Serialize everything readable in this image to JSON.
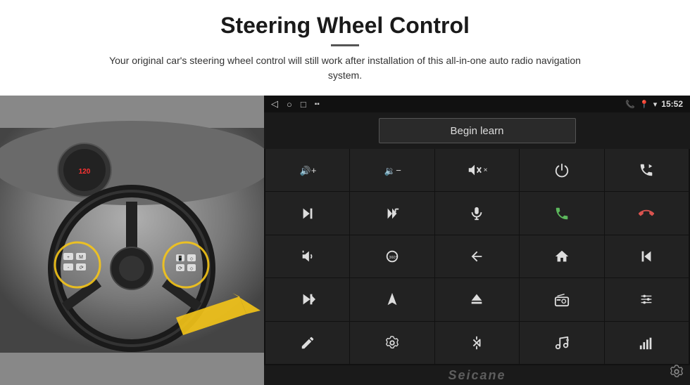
{
  "header": {
    "title": "Steering Wheel Control",
    "subtitle": "Your original car's steering wheel control will still work after installation of this all-in-one auto radio navigation system."
  },
  "screen": {
    "status_bar": {
      "time": "15:52",
      "icons_left": [
        "back-arrow",
        "home-circle",
        "square"
      ],
      "icons_right": [
        "phone-icon",
        "location-icon",
        "wifi-icon",
        "battery-icon"
      ]
    },
    "begin_learn_label": "Begin learn",
    "watermark": "Seicane",
    "icons": [
      {
        "id": "vol-up",
        "symbol": "🔊+"
      },
      {
        "id": "vol-down",
        "symbol": "🔉-"
      },
      {
        "id": "mute",
        "symbol": "🔇"
      },
      {
        "id": "power",
        "symbol": "⏻"
      },
      {
        "id": "prev-track",
        "symbol": "⏮"
      },
      {
        "id": "next-track",
        "symbol": "⏭"
      },
      {
        "id": "ff",
        "symbol": "⏩"
      },
      {
        "id": "mic",
        "symbol": "🎙"
      },
      {
        "id": "phone",
        "symbol": "📞"
      },
      {
        "id": "hang-up",
        "symbol": "📵"
      },
      {
        "id": "horn",
        "symbol": "📣"
      },
      {
        "id": "360-cam",
        "symbol": "🔁"
      },
      {
        "id": "back",
        "symbol": "↩"
      },
      {
        "id": "home",
        "symbol": "⌂"
      },
      {
        "id": "skip-back",
        "symbol": "⏮"
      },
      {
        "id": "skip-fwd",
        "symbol": "⏭"
      },
      {
        "id": "nav",
        "symbol": "➤"
      },
      {
        "id": "eject",
        "symbol": "⏏"
      },
      {
        "id": "radio",
        "symbol": "📻"
      },
      {
        "id": "eq",
        "symbol": "🎚"
      },
      {
        "id": "pen",
        "symbol": "✏"
      },
      {
        "id": "settings2",
        "symbol": "⚙"
      },
      {
        "id": "bluetooth",
        "symbol": "✦"
      },
      {
        "id": "music",
        "symbol": "🎵"
      },
      {
        "id": "bars",
        "symbol": "📊"
      }
    ]
  }
}
